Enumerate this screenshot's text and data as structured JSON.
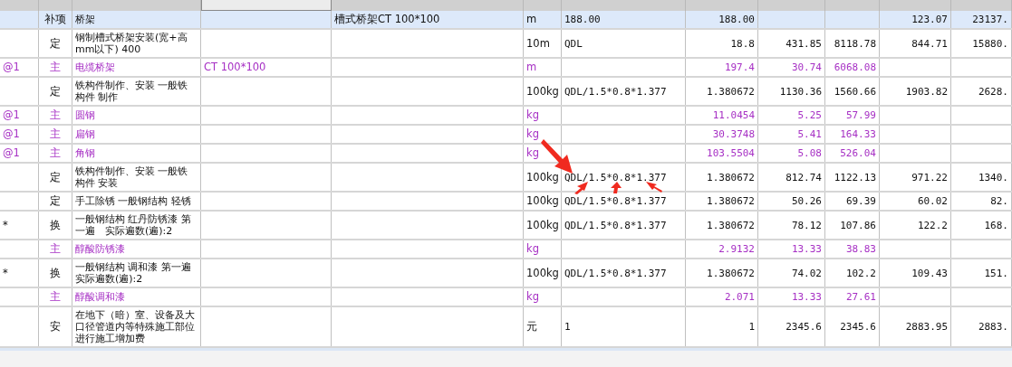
{
  "table": {
    "rows": [
      {
        "kind": "summary",
        "selected": true,
        "column_2": "补项",
        "column_3": "桥架",
        "column_5": "槽式桥架CT 100*100",
        "column_6": "m",
        "column_7": "188.00",
        "column_8": "188.00",
        "column_11": "123.07",
        "column_12": "23137."
      },
      {
        "kind": "quota",
        "selected": false,
        "column_2": "定",
        "column_3": "钢制槽式桥架安装(宽+高mm以下) 400",
        "column_6": "10m",
        "column_7": "QDL",
        "column_8": "18.8",
        "column_9": "431.85",
        "column_10": "8118.78",
        "column_11": "844.71",
        "column_12": "15880."
      },
      {
        "kind": "material",
        "selected": false,
        "column_1": "@1",
        "column_2": "主",
        "column_3": "电缆桥架",
        "column_4": "CT 100*100",
        "column_6": "m",
        "column_8": "197.4",
        "column_9": "30.74",
        "column_10": "6068.08"
      },
      {
        "kind": "quota",
        "selected": false,
        "column_2": "定",
        "column_3": "铁构件制作、安装 一般铁构件 制作",
        "column_6": "100kg",
        "column_7": "QDL/1.5*0.8*1.377",
        "column_8": "1.380672",
        "column_9": "1130.36",
        "column_10": "1560.66",
        "column_11": "1903.82",
        "column_12": "2628."
      },
      {
        "kind": "material",
        "selected": false,
        "column_1": "@1",
        "column_2": "主",
        "column_3": "圆钢",
        "column_6": "kg",
        "column_8": "11.0454",
        "column_9": "5.25",
        "column_10": "57.99"
      },
      {
        "kind": "material",
        "selected": false,
        "column_1": "@1",
        "column_2": "主",
        "column_3": "扁钢",
        "column_6": "kg",
        "column_8": "30.3748",
        "column_9": "5.41",
        "column_10": "164.33"
      },
      {
        "kind": "material",
        "selected": false,
        "column_1": "@1",
        "column_2": "主",
        "column_3": "角钢",
        "column_6": "kg",
        "column_8": "103.5504",
        "column_9": "5.08",
        "column_10": "526.04"
      },
      {
        "kind": "quota",
        "selected": false,
        "column_2": "定",
        "column_3": "铁构件制作、安装 一般铁构件 安装",
        "column_6": "100kg",
        "column_7": "QDL/1.5*0.8*1.377",
        "column_8": "1.380672",
        "column_9": "812.74",
        "column_10": "1122.13",
        "column_11": "971.22",
        "column_12": "1340."
      },
      {
        "kind": "quota",
        "selected": false,
        "column_2": "定",
        "column_3": "手工除锈 一般钢结构 轻锈",
        "column_6": "100kg",
        "column_7": "QDL/1.5*0.8*1.377",
        "column_8": "1.380672",
        "column_9": "50.26",
        "column_10": "69.39",
        "column_11": "60.02",
        "column_12": "82."
      },
      {
        "kind": "quota",
        "selected": false,
        "column_1": "*",
        "column_2": "换",
        "column_3": "一般钢结构 红丹防锈漆 第一遍　实际遍数(遍):2",
        "column_6": "100kg",
        "column_7": "QDL/1.5*0.8*1.377",
        "column_8": "1.380672",
        "column_9": "78.12",
        "column_10": "107.86",
        "column_11": "122.2",
        "column_12": "168."
      },
      {
        "kind": "material",
        "selected": false,
        "column_2": "主",
        "column_3": "醇酸防锈漆",
        "column_6": "kg",
        "column_8": "2.9132",
        "column_9": "13.33",
        "column_10": "38.83"
      },
      {
        "kind": "quota",
        "selected": false,
        "column_1": "*",
        "column_2": "换",
        "column_3": "一般钢结构 调和漆 第一遍实际遍数(遍):2",
        "column_6": "100kg",
        "column_7": "QDL/1.5*0.8*1.377",
        "column_8": "1.380672",
        "column_9": "74.02",
        "column_10": "102.2",
        "column_11": "109.43",
        "column_12": "151."
      },
      {
        "kind": "material",
        "selected": false,
        "column_2": "主",
        "column_3": "醇酸调和漆",
        "column_6": "kg",
        "column_8": "2.071",
        "column_9": "13.33",
        "column_10": "27.61"
      },
      {
        "kind": "quota",
        "selected": false,
        "column_2": "安",
        "column_3": "在地下（暗）室、设备及大口径管道内等特殊施工部位进行施工增加费",
        "column_6": "元",
        "column_7": "1",
        "column_8": "1",
        "column_9": "2345.6",
        "column_10": "2345.6",
        "column_11": "2883.95",
        "column_12": "2883."
      }
    ]
  }
}
